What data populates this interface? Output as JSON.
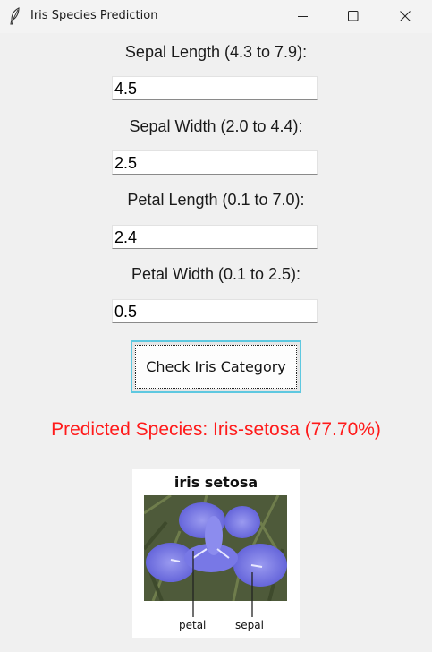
{
  "window": {
    "title": "Iris Species Prediction",
    "icon": "feather-icon",
    "controls": [
      "minimize-icon",
      "maximize-icon",
      "close-icon"
    ]
  },
  "form": {
    "sepal_length": {
      "label": "Sepal Length (4.3 to 7.9):",
      "value": "4.5"
    },
    "sepal_width": {
      "label": "Sepal Width (2.0 to 4.4):",
      "value": "2.5"
    },
    "petal_length": {
      "label": "Petal Length (0.1 to 7.0):",
      "value": "2.4"
    },
    "petal_width": {
      "label": "Petal Width (0.1 to 2.5):",
      "value": "0.5"
    },
    "submit_label": "Check Iris Category"
  },
  "result": {
    "prediction_text": "Predicted Species: Iris-setosa (77.70%)",
    "color": "#ff1a1a",
    "image": {
      "title": "iris setosa",
      "labels": {
        "petal": "petal",
        "sepal": "sepal"
      }
    }
  },
  "colors": {
    "window_bg": "#f0f0f0",
    "button_focus_border": "#5ec8e0",
    "flower": "#6f6fe0"
  }
}
